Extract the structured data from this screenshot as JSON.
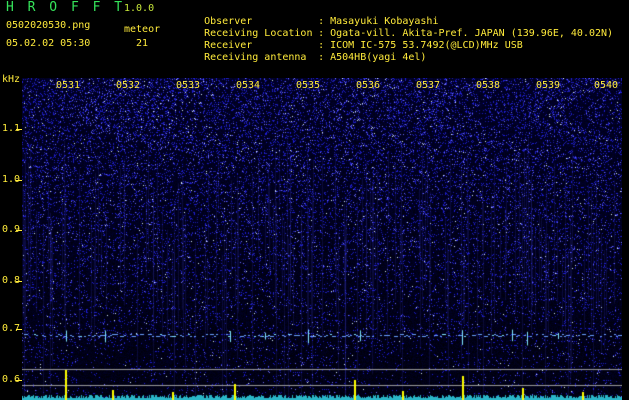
{
  "header": {
    "app_title": "H R O F F T",
    "version": "1.0.0",
    "file_name": "0502020530.png",
    "meteor_label": "meteor",
    "timestamp": "05.02.02 05:30",
    "meteor_count": "21",
    "info": [
      {
        "key": "Observer",
        "value": "Masayuki Kobayashi"
      },
      {
        "key": "Receiving Location",
        "value": "Ogata-vill. Akita-Pref. JAPAN (139.96E, 40.02N)"
      },
      {
        "key": "Receiver",
        "value": "ICOM IC-575 53.7492(@LCD)MHz USB"
      },
      {
        "key": "Receiving antenna",
        "value": "A504HB(yagi 4el)"
      }
    ]
  },
  "chart_data": {
    "type": "heatmap",
    "y_unit": "kHz",
    "y_ticks": [
      "1.1",
      "1.0",
      "0.9",
      "0.8",
      "0.7",
      "0.6"
    ],
    "x_ticks": [
      "0531",
      "0532",
      "0533",
      "0534",
      "0535",
      "0536",
      "0537",
      "0538",
      "0539",
      "0540"
    ],
    "colors": {
      "label": "#ffeb3b",
      "title": "#35e35a",
      "noise": "#2323a8",
      "echo": "#7fe6ff",
      "bars": "#ffff00"
    }
  }
}
